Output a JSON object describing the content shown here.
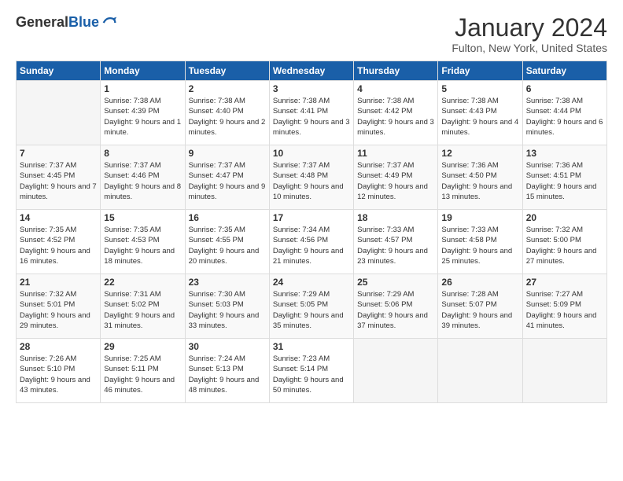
{
  "logo": {
    "general": "General",
    "blue": "Blue"
  },
  "header": {
    "title": "January 2024",
    "location": "Fulton, New York, United States"
  },
  "days_of_week": [
    "Sunday",
    "Monday",
    "Tuesday",
    "Wednesday",
    "Thursday",
    "Friday",
    "Saturday"
  ],
  "weeks": [
    [
      {
        "day": "",
        "sunrise": "",
        "sunset": "",
        "daylight": "",
        "empty": true
      },
      {
        "day": "1",
        "sunrise": "Sunrise: 7:38 AM",
        "sunset": "Sunset: 4:39 PM",
        "daylight": "Daylight: 9 hours and 1 minute.",
        "empty": false
      },
      {
        "day": "2",
        "sunrise": "Sunrise: 7:38 AM",
        "sunset": "Sunset: 4:40 PM",
        "daylight": "Daylight: 9 hours and 2 minutes.",
        "empty": false
      },
      {
        "day": "3",
        "sunrise": "Sunrise: 7:38 AM",
        "sunset": "Sunset: 4:41 PM",
        "daylight": "Daylight: 9 hours and 3 minutes.",
        "empty": false
      },
      {
        "day": "4",
        "sunrise": "Sunrise: 7:38 AM",
        "sunset": "Sunset: 4:42 PM",
        "daylight": "Daylight: 9 hours and 3 minutes.",
        "empty": false
      },
      {
        "day": "5",
        "sunrise": "Sunrise: 7:38 AM",
        "sunset": "Sunset: 4:43 PM",
        "daylight": "Daylight: 9 hours and 4 minutes.",
        "empty": false
      },
      {
        "day": "6",
        "sunrise": "Sunrise: 7:38 AM",
        "sunset": "Sunset: 4:44 PM",
        "daylight": "Daylight: 9 hours and 6 minutes.",
        "empty": false
      }
    ],
    [
      {
        "day": "7",
        "sunrise": "Sunrise: 7:37 AM",
        "sunset": "Sunset: 4:45 PM",
        "daylight": "Daylight: 9 hours and 7 minutes.",
        "empty": false
      },
      {
        "day": "8",
        "sunrise": "Sunrise: 7:37 AM",
        "sunset": "Sunset: 4:46 PM",
        "daylight": "Daylight: 9 hours and 8 minutes.",
        "empty": false
      },
      {
        "day": "9",
        "sunrise": "Sunrise: 7:37 AM",
        "sunset": "Sunset: 4:47 PM",
        "daylight": "Daylight: 9 hours and 9 minutes.",
        "empty": false
      },
      {
        "day": "10",
        "sunrise": "Sunrise: 7:37 AM",
        "sunset": "Sunset: 4:48 PM",
        "daylight": "Daylight: 9 hours and 10 minutes.",
        "empty": false
      },
      {
        "day": "11",
        "sunrise": "Sunrise: 7:37 AM",
        "sunset": "Sunset: 4:49 PM",
        "daylight": "Daylight: 9 hours and 12 minutes.",
        "empty": false
      },
      {
        "day": "12",
        "sunrise": "Sunrise: 7:36 AM",
        "sunset": "Sunset: 4:50 PM",
        "daylight": "Daylight: 9 hours and 13 minutes.",
        "empty": false
      },
      {
        "day": "13",
        "sunrise": "Sunrise: 7:36 AM",
        "sunset": "Sunset: 4:51 PM",
        "daylight": "Daylight: 9 hours and 15 minutes.",
        "empty": false
      }
    ],
    [
      {
        "day": "14",
        "sunrise": "Sunrise: 7:35 AM",
        "sunset": "Sunset: 4:52 PM",
        "daylight": "Daylight: 9 hours and 16 minutes.",
        "empty": false
      },
      {
        "day": "15",
        "sunrise": "Sunrise: 7:35 AM",
        "sunset": "Sunset: 4:53 PM",
        "daylight": "Daylight: 9 hours and 18 minutes.",
        "empty": false
      },
      {
        "day": "16",
        "sunrise": "Sunrise: 7:35 AM",
        "sunset": "Sunset: 4:55 PM",
        "daylight": "Daylight: 9 hours and 20 minutes.",
        "empty": false
      },
      {
        "day": "17",
        "sunrise": "Sunrise: 7:34 AM",
        "sunset": "Sunset: 4:56 PM",
        "daylight": "Daylight: 9 hours and 21 minutes.",
        "empty": false
      },
      {
        "day": "18",
        "sunrise": "Sunrise: 7:33 AM",
        "sunset": "Sunset: 4:57 PM",
        "daylight": "Daylight: 9 hours and 23 minutes.",
        "empty": false
      },
      {
        "day": "19",
        "sunrise": "Sunrise: 7:33 AM",
        "sunset": "Sunset: 4:58 PM",
        "daylight": "Daylight: 9 hours and 25 minutes.",
        "empty": false
      },
      {
        "day": "20",
        "sunrise": "Sunrise: 7:32 AM",
        "sunset": "Sunset: 5:00 PM",
        "daylight": "Daylight: 9 hours and 27 minutes.",
        "empty": false
      }
    ],
    [
      {
        "day": "21",
        "sunrise": "Sunrise: 7:32 AM",
        "sunset": "Sunset: 5:01 PM",
        "daylight": "Daylight: 9 hours and 29 minutes.",
        "empty": false
      },
      {
        "day": "22",
        "sunrise": "Sunrise: 7:31 AM",
        "sunset": "Sunset: 5:02 PM",
        "daylight": "Daylight: 9 hours and 31 minutes.",
        "empty": false
      },
      {
        "day": "23",
        "sunrise": "Sunrise: 7:30 AM",
        "sunset": "Sunset: 5:03 PM",
        "daylight": "Daylight: 9 hours and 33 minutes.",
        "empty": false
      },
      {
        "day": "24",
        "sunrise": "Sunrise: 7:29 AM",
        "sunset": "Sunset: 5:05 PM",
        "daylight": "Daylight: 9 hours and 35 minutes.",
        "empty": false
      },
      {
        "day": "25",
        "sunrise": "Sunrise: 7:29 AM",
        "sunset": "Sunset: 5:06 PM",
        "daylight": "Daylight: 9 hours and 37 minutes.",
        "empty": false
      },
      {
        "day": "26",
        "sunrise": "Sunrise: 7:28 AM",
        "sunset": "Sunset: 5:07 PM",
        "daylight": "Daylight: 9 hours and 39 minutes.",
        "empty": false
      },
      {
        "day": "27",
        "sunrise": "Sunrise: 7:27 AM",
        "sunset": "Sunset: 5:09 PM",
        "daylight": "Daylight: 9 hours and 41 minutes.",
        "empty": false
      }
    ],
    [
      {
        "day": "28",
        "sunrise": "Sunrise: 7:26 AM",
        "sunset": "Sunset: 5:10 PM",
        "daylight": "Daylight: 9 hours and 43 minutes.",
        "empty": false
      },
      {
        "day": "29",
        "sunrise": "Sunrise: 7:25 AM",
        "sunset": "Sunset: 5:11 PM",
        "daylight": "Daylight: 9 hours and 46 minutes.",
        "empty": false
      },
      {
        "day": "30",
        "sunrise": "Sunrise: 7:24 AM",
        "sunset": "Sunset: 5:13 PM",
        "daylight": "Daylight: 9 hours and 48 minutes.",
        "empty": false
      },
      {
        "day": "31",
        "sunrise": "Sunrise: 7:23 AM",
        "sunset": "Sunset: 5:14 PM",
        "daylight": "Daylight: 9 hours and 50 minutes.",
        "empty": false
      },
      {
        "day": "",
        "sunrise": "",
        "sunset": "",
        "daylight": "",
        "empty": true
      },
      {
        "day": "",
        "sunrise": "",
        "sunset": "",
        "daylight": "",
        "empty": true
      },
      {
        "day": "",
        "sunrise": "",
        "sunset": "",
        "daylight": "",
        "empty": true
      }
    ]
  ]
}
